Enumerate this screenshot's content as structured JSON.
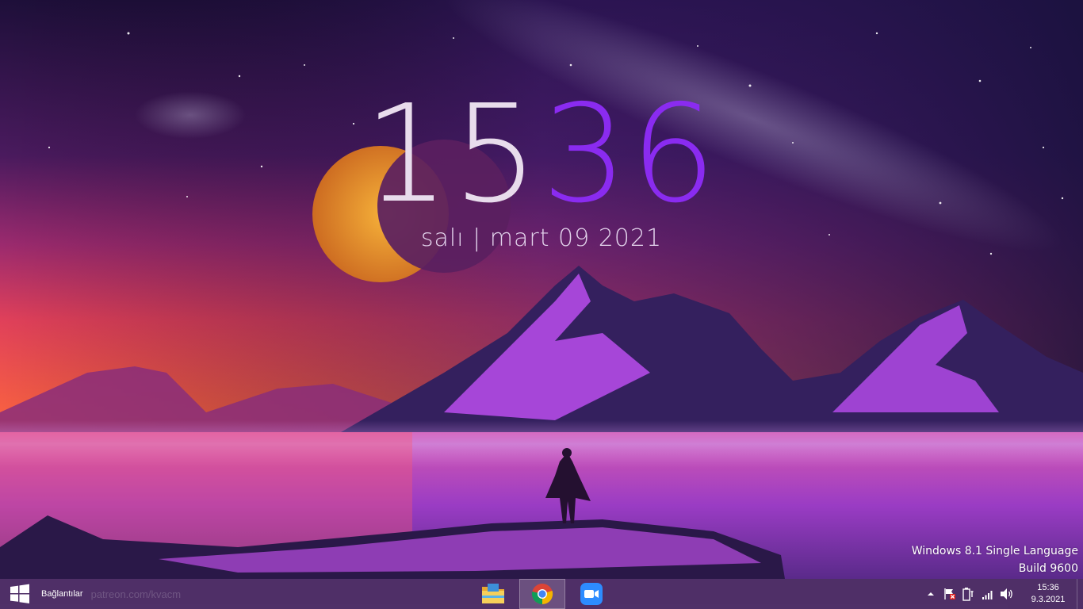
{
  "clock_widget": {
    "hours": "15",
    "minutes": "36",
    "date_line": "salı | mart 09 2021"
  },
  "watermark": {
    "line1": "Windows 8.1 Single Language",
    "line2": "Build 9600"
  },
  "taskbar": {
    "start_icon": "windows-logo-icon",
    "connections_label": "Bağlantılar",
    "link_text": "patreon.com/kvacm",
    "pinned": [
      {
        "name": "file-explorer-icon"
      },
      {
        "name": "chrome-icon"
      },
      {
        "name": "zoom-icon"
      }
    ],
    "tray_icons": [
      "show-hidden-icons",
      "action-center-flag-icon",
      "battery-plug-icon",
      "network-signal-icon",
      "volume-icon"
    ],
    "time": "15:36",
    "date": "9.3.2021"
  },
  "colors": {
    "minutes_accent": "#8a2bf0",
    "taskbar": "#58376e"
  }
}
